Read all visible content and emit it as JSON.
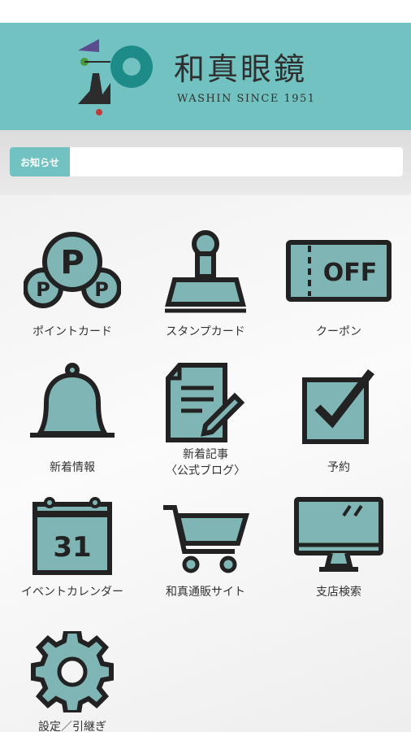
{
  "header": {
    "brand_name": "和真眼鏡",
    "brand_sub": "WASHIN SINCE 1951"
  },
  "news": {
    "label": "お知らせ",
    "text": ""
  },
  "menu": [
    {
      "label": "ポイントカード",
      "icon": "points-icon"
    },
    {
      "label": "スタンプカード",
      "icon": "stamp-icon"
    },
    {
      "label": "クーポン",
      "icon": "coupon-icon",
      "icon_text": "OFF"
    },
    {
      "label": "新着情報",
      "icon": "bell-icon"
    },
    {
      "label": "新着記事\n〈公式ブログ〉",
      "icon": "document-icon"
    },
    {
      "label": "予約",
      "icon": "checkbox-icon"
    },
    {
      "label": "イベントカレンダー",
      "icon": "calendar-icon",
      "icon_text": "31"
    },
    {
      "label": "和真通販サイト",
      "icon": "cart-icon"
    },
    {
      "label": "支店検索",
      "icon": "monitor-icon"
    },
    {
      "label": "設定／引継ぎ",
      "icon": "gear-icon"
    }
  ],
  "points_icon_letters": [
    "P",
    "P",
    "P"
  ],
  "colors": {
    "header_teal": "#72c2c1",
    "icon_fill": "#7fb5b4",
    "icon_stroke": "#222222"
  }
}
